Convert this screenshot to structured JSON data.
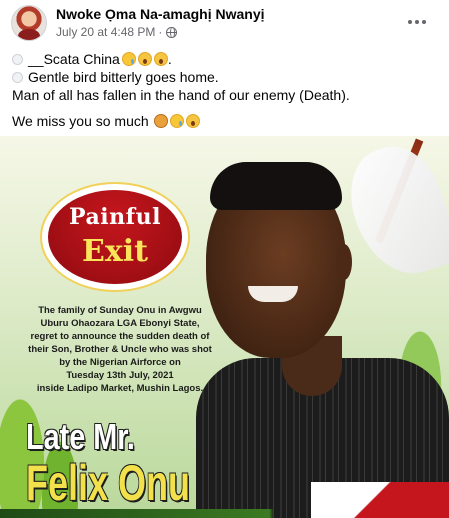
{
  "post": {
    "author": "Nwoke Ọma Na-amaghị Nwanyị",
    "date": "July 20 at 4:48 PM",
    "privacy_icon": "globe-icon",
    "more_icon": "more-options-icon",
    "lines": [
      "__Scata China",
      "Gentle bird bitterly goes home.",
      "Man of all has fallen in the hand of our enemy (Death).",
      "We miss you so much"
    ]
  },
  "poster": {
    "badge_top": "Painful",
    "badge_bottom": "Exit",
    "notice_lines": [
      "The family of Sunday Onu in Awgwu",
      "Uburu Ohaozara LGA Ebonyi State,",
      "regret to announce the sudden death of",
      "their Son, Brother & Uncle who was shot",
      "by the Nigerian Airforce on",
      "Tuesday 13th July, 2021",
      "inside Ladipo Market, Mushin Lagos."
    ],
    "late_label": "Late Mr.",
    "name": "Felix Onu"
  },
  "colors": {
    "badge_red": "#c5161d",
    "name_yellow": "#f2e14a",
    "meta_gray": "#65676b"
  }
}
